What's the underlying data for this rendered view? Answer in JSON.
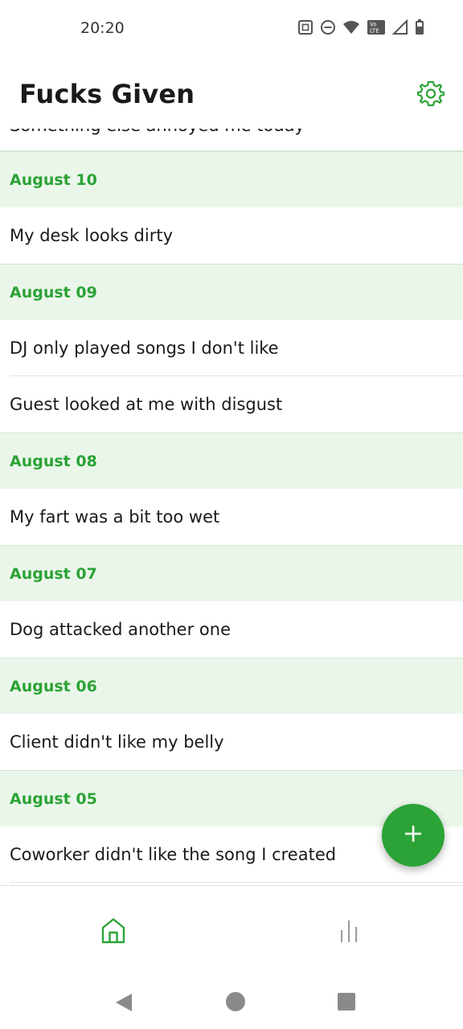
{
  "status_bar": {
    "time": "20:20",
    "icons": [
      "nfc-icon",
      "do-not-disturb-icon",
      "wifi-icon",
      "volte-icon",
      "signal-icon",
      "battery-icon"
    ],
    "volte_label_top": "Vo",
    "volte_label_bottom": "LTE"
  },
  "app_bar": {
    "title": "Fucks Given",
    "settings_icon": "gear-icon"
  },
  "list": {
    "partial_entry": "Something else annoyed me today",
    "groups": [
      {
        "date": "August 10",
        "entries": [
          "My desk looks dirty"
        ]
      },
      {
        "date": "August 09",
        "entries": [
          "DJ only played songs I don't like",
          "Guest looked at me with disgust"
        ]
      },
      {
        "date": "August 08",
        "entries": [
          "My fart was a bit too wet"
        ]
      },
      {
        "date": "August 07",
        "entries": [
          "Dog attacked another one"
        ]
      },
      {
        "date": "August 06",
        "entries": [
          "Client didn't like my belly"
        ]
      },
      {
        "date": "August 05",
        "entries": [
          "Coworker didn't like the song I created"
        ]
      }
    ]
  },
  "fab": {
    "icon": "plus-icon"
  },
  "bottom_nav": {
    "items": [
      {
        "icon": "home-icon",
        "active": true
      },
      {
        "icon": "bar-chart-icon",
        "active": false
      }
    ]
  },
  "system_nav": {
    "icons": [
      "back-icon",
      "home-circle-icon",
      "recents-icon"
    ]
  },
  "colors": {
    "accent": "#2ba336",
    "header_bg": "#ebf6ea",
    "text": "#1a1a1a",
    "inactive_icon": "#9e9e9e"
  }
}
